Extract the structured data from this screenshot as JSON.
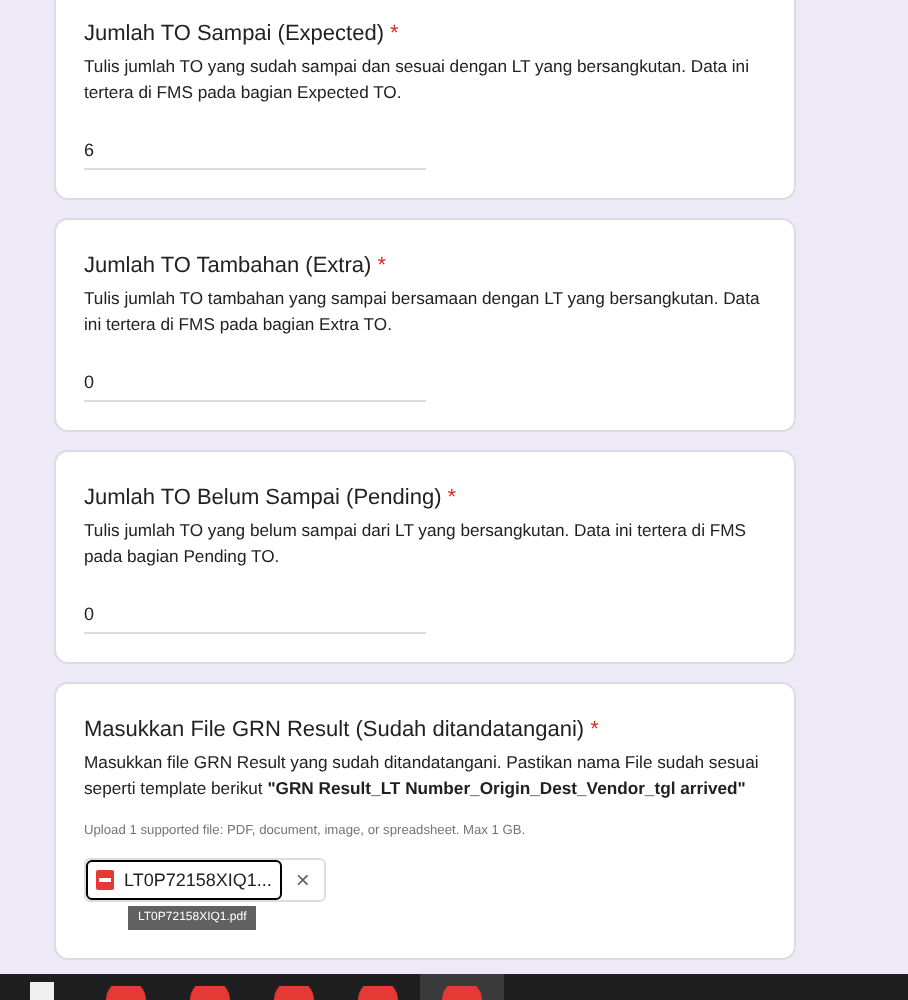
{
  "questions": [
    {
      "kind": "text",
      "title": "Jumlah TO Sampai (Expected)",
      "required": true,
      "required_mark": "*",
      "description": "Tulis jumlah TO yang sudah sampai dan sesuai dengan LT yang bersangkutan. Data ini tertera di FMS pada bagian Expected TO.",
      "value": "6"
    },
    {
      "kind": "text",
      "title": "Jumlah TO Tambahan (Extra)",
      "required": true,
      "required_mark": "*",
      "description": "Tulis jumlah TO tambahan yang sampai bersamaan dengan LT yang bersangkutan. Data ini  tertera di FMS pada bagian Extra TO.",
      "value": "0"
    },
    {
      "kind": "text",
      "title": "Jumlah TO Belum Sampai (Pending)",
      "required": true,
      "required_mark": "*",
      "description": "Tulis jumlah TO yang belum sampai dari LT yang bersangkutan. Data ini  tertera di FMS pada bagian Pending TO.",
      "value": "0"
    },
    {
      "kind": "file",
      "title": "Masukkan File GRN Result (Sudah ditandatangani)",
      "required": true,
      "required_mark": "*",
      "description": "Masukkan file GRN Result yang sudah ditandatangani. Pastikan nama File sudah sesuai seperti template berikut **\"GRN Result_LT Number_Origin_Dest_Vendor_tgl arrived\"**",
      "hint": "Upload 1 supported file: PDF, document, image, or spreadsheet. Max 1 GB.",
      "file": {
        "name": "LT0P72158XIQ1...",
        "tooltip": "LT0P72158XIQ1.pdf",
        "remove": "×"
      }
    }
  ],
  "taskbar": {
    "items": [
      {
        "kind": "doc",
        "selected": false
      },
      {
        "kind": "app",
        "selected": false
      },
      {
        "kind": "app",
        "selected": false
      },
      {
        "kind": "app",
        "selected": false
      },
      {
        "kind": "app",
        "selected": false
      },
      {
        "kind": "app",
        "selected": true
      }
    ]
  }
}
